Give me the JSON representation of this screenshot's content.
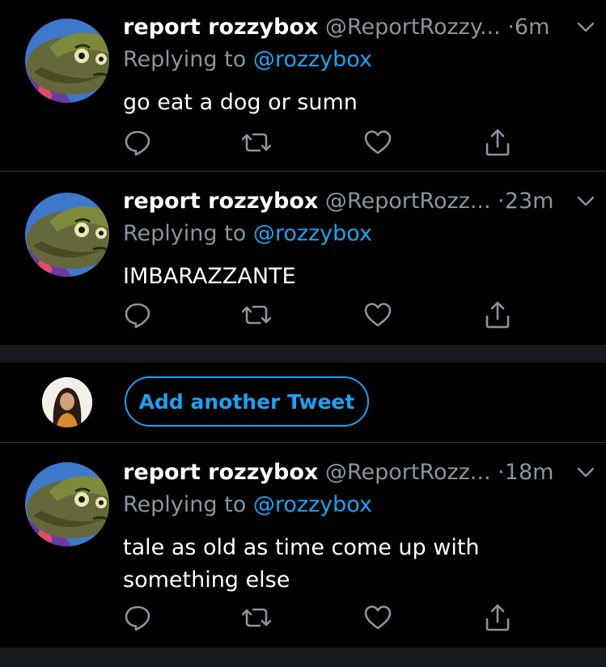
{
  "tweets": [
    {
      "name": "report rozzybox",
      "handle": "@ReportRozzy...",
      "dot": "·",
      "time": "6m",
      "replying_prefix": "Replying to ",
      "replying_to": "@rozzybox",
      "text": "go eat a dog or sumn"
    },
    {
      "name": "report rozzybox",
      "handle": "@ReportRozz...",
      "dot": "·",
      "time": "23m",
      "replying_prefix": "Replying to ",
      "replying_to": "@rozzybox",
      "text": "IMBARAZZANTE"
    },
    {
      "name": "report rozzybox",
      "handle": "@ReportRozz...",
      "dot": "·",
      "time": "18m",
      "replying_prefix": "Replying to ",
      "replying_to": "@rozzybox",
      "text": "tale as old as time come up with something else"
    }
  ],
  "compose": {
    "button_label": "Add another Tweet"
  },
  "icons": {
    "reply": "reply-icon",
    "retweet": "retweet-icon",
    "like": "heart-icon",
    "share": "share-icon",
    "more": "chevron-down-icon"
  },
  "colors": {
    "background": "#000000",
    "text": "#ffffff",
    "secondary": "#8a959e",
    "accent": "#1da1f2",
    "divider": "#2f3336",
    "section_gap": "#15181c"
  }
}
